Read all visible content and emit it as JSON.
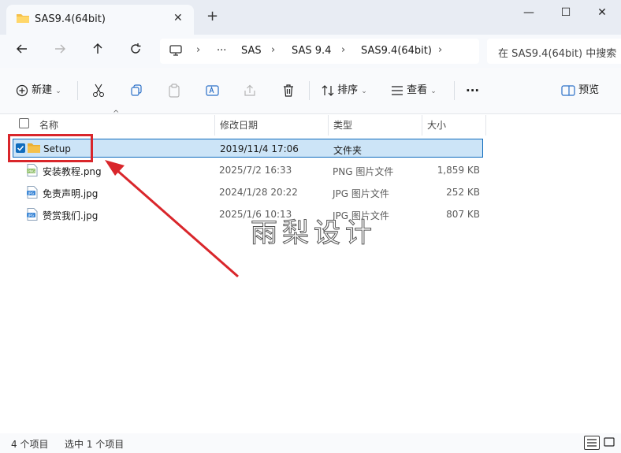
{
  "tab": {
    "title": "SAS9.4(64bit)",
    "close": "✕",
    "new": "+"
  },
  "window": {
    "minimize": "—",
    "maximize": "☐",
    "close": "✕"
  },
  "address": {
    "crumbs": [
      "SAS",
      "SAS 9.4",
      "SAS9.4(64bit)"
    ],
    "more": "···",
    "search_placeholder": "在 SAS9.4(64bit) 中搜索"
  },
  "toolbar": {
    "new_label": "新建",
    "sort_label": "排序",
    "view_label": "查看",
    "more": "···",
    "preview_label": "预览"
  },
  "columns": {
    "name": "名称",
    "date": "修改日期",
    "type": "类型",
    "size": "大小"
  },
  "files": [
    {
      "name": "Setup",
      "date": "2019/11/4 17:06",
      "type": "文件夹",
      "size": "",
      "icon": "folder-icon",
      "selected": true
    },
    {
      "name": "安装教程.png",
      "date": "2025/7/2 16:33",
      "type": "PNG 图片文件",
      "size": "1,859 KB",
      "icon": "png-file-icon",
      "selected": false
    },
    {
      "name": "免责声明.jpg",
      "date": "2024/1/28 20:22",
      "type": "JPG 图片文件",
      "size": "252 KB",
      "icon": "jpg-file-icon",
      "selected": false
    },
    {
      "name": "赞赏我们.jpg",
      "date": "2025/1/6 10:13",
      "type": "JPG 图片文件",
      "size": "807 KB",
      "icon": "jpg-file-icon",
      "selected": false
    }
  ],
  "watermark": "雨梨设计",
  "status": {
    "count": "4 个项目",
    "selected": "选中 1 个项目"
  },
  "colors": {
    "accent": "#0f6cbd",
    "selection": "#cce4f7",
    "annotation": "#d9262b",
    "folder": "#f5c04a"
  }
}
